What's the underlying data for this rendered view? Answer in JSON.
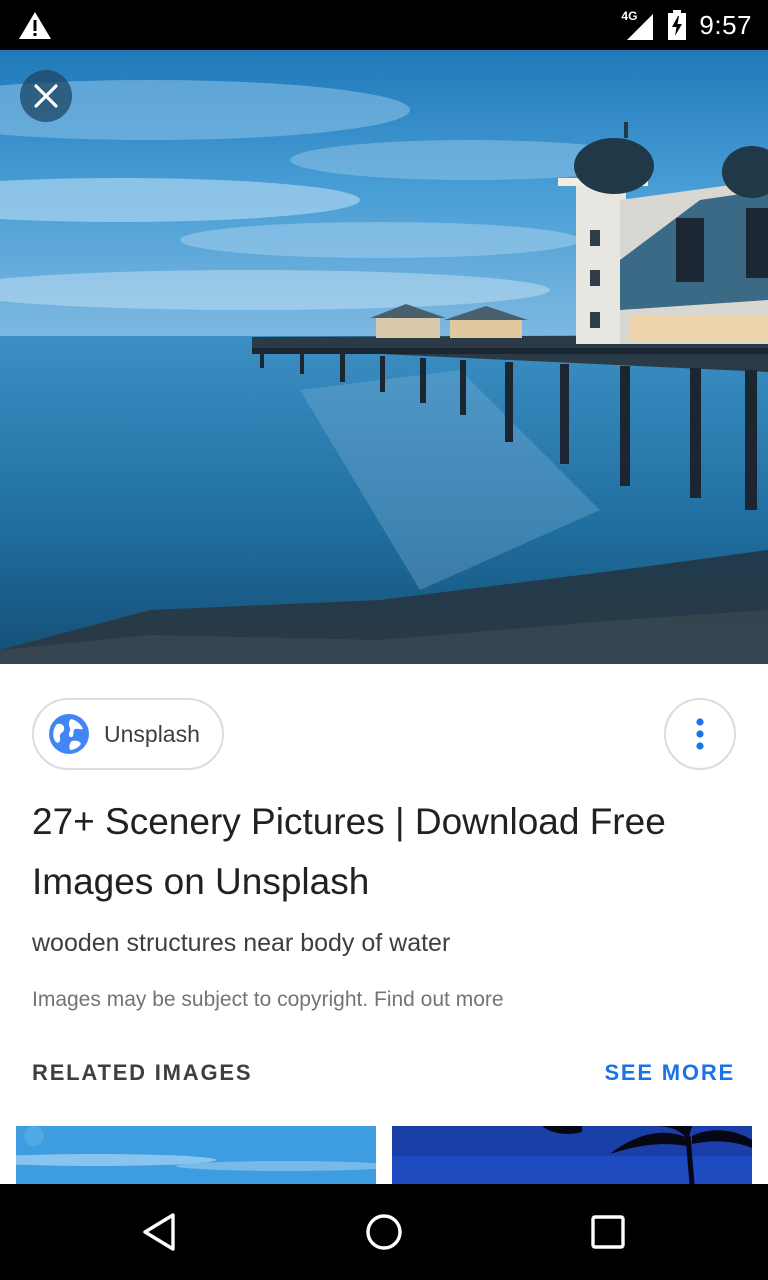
{
  "status_bar": {
    "network": "4G",
    "time": "9:57",
    "icons": [
      "warning-icon",
      "signal-icon",
      "battery-charging-icon"
    ]
  },
  "viewer": {
    "close_icon": "close-icon",
    "source": {
      "label": "Unsplash",
      "icon": "globe-icon"
    },
    "more_icon": "more-vert-icon",
    "title": "27+ Scenery Pictures | Download Free Images on Unsplash",
    "description": "wooden structures near body of water",
    "copyright_notice": "Images may be subject to copyright. Find out more"
  },
  "related": {
    "heading": "RELATED IMAGES",
    "see_more": "SEE MORE"
  },
  "colors": {
    "accent": "#1a73e8",
    "status_bar": "#000000",
    "text_primary": "#202124",
    "text_secondary": "#70757a",
    "chip_border": "#dadce0"
  },
  "nav_bar": {
    "icons": [
      "back-icon",
      "home-icon",
      "recents-icon"
    ]
  }
}
